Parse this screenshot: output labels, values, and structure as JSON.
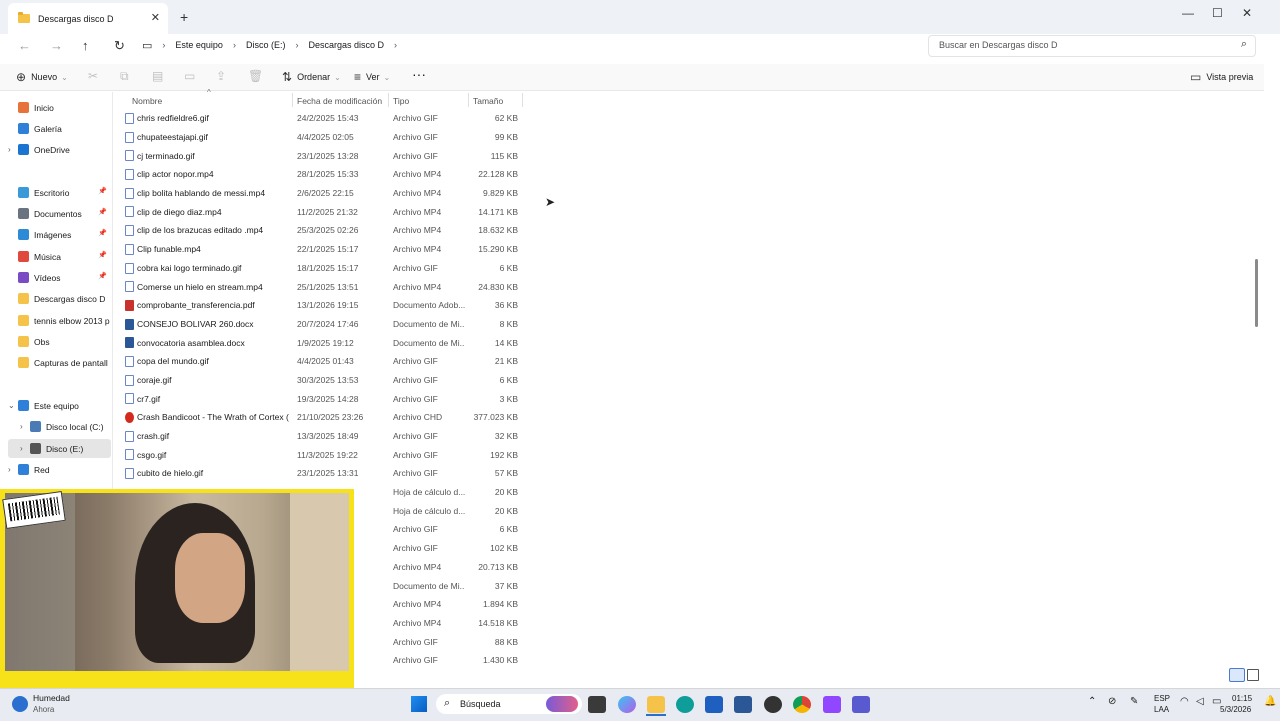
{
  "window": {
    "tab_title": "Descargas disco D",
    "new_tab": "+",
    "close_tab": "✕"
  },
  "address": {
    "breadcrumbs": [
      "Este equipo",
      "Disco (E:)",
      "Descargas disco D"
    ],
    "search_placeholder": "Buscar en Descargas disco D"
  },
  "toolbar": {
    "new_label": "Nuevo",
    "sort_label": "Ordenar",
    "view_label": "Ver",
    "more_label": "···",
    "preview_label": "Vista previa"
  },
  "sidebar": {
    "items": [
      {
        "label": "Inicio",
        "color": "#e8733a"
      },
      {
        "label": "Galería",
        "color": "#2f80d8"
      },
      {
        "label": "OneDrive",
        "color": "#1b74d0"
      },
      {
        "label": "Escritorio",
        "color": "#3a9ad9"
      },
      {
        "label": "Documentos",
        "color": "#6a7480"
      },
      {
        "label": "Imágenes",
        "color": "#2d8ad6"
      },
      {
        "label": "Música",
        "color": "#e04a3c"
      },
      {
        "label": "Vídeos",
        "color": "#7a4bc2"
      },
      {
        "label": "Descargas disco D",
        "color": "#f6c34a"
      },
      {
        "label": "tennis elbow 2013 p",
        "color": "#f6c34a"
      },
      {
        "label": "Obs",
        "color": "#f6c34a"
      },
      {
        "label": "Capturas de pantall",
        "color": "#f6c34a"
      },
      {
        "label": "Este equipo",
        "color": "#2f80d8"
      },
      {
        "label": "Disco local (C:)",
        "color": "#4a7bb5"
      },
      {
        "label": "Disco (E:)",
        "color": "#555555"
      },
      {
        "label": "Red",
        "color": "#2f80d8"
      }
    ]
  },
  "columns": {
    "name": "Nombre",
    "date": "Fecha de modificación",
    "type": "Tipo",
    "size": "Tamaño"
  },
  "files": [
    {
      "name": "chris redfieldre6.gif",
      "date": "24/2/2025 15:43",
      "type": "Archivo GIF",
      "size": "62 KB",
      "kind": "gif"
    },
    {
      "name": "chupateestajapi.gif",
      "date": "4/4/2025 02:05",
      "type": "Archivo GIF",
      "size": "99 KB",
      "kind": "gif"
    },
    {
      "name": "cj terminado.gif",
      "date": "23/1/2025 13:28",
      "type": "Archivo GIF",
      "size": "115 KB",
      "kind": "gif"
    },
    {
      "name": "clip actor nopor.mp4",
      "date": "28/1/2025 15:33",
      "type": "Archivo MP4",
      "size": "22.128 KB",
      "kind": "mp4"
    },
    {
      "name": "clip bolita hablando de messi.mp4",
      "date": "2/6/2025 22:15",
      "type": "Archivo MP4",
      "size": "9.829 KB",
      "kind": "mp4"
    },
    {
      "name": "clip de diego diaz.mp4",
      "date": "11/2/2025 21:32",
      "type": "Archivo MP4",
      "size": "14.171 KB",
      "kind": "mp4"
    },
    {
      "name": "clip de los brazucas editado .mp4",
      "date": "25/3/2025 02:26",
      "type": "Archivo MP4",
      "size": "18.632 KB",
      "kind": "mp4"
    },
    {
      "name": "Clip funable.mp4",
      "date": "22/1/2025 15:17",
      "type": "Archivo MP4",
      "size": "15.290 KB",
      "kind": "mp4"
    },
    {
      "name": "cobra kai logo terminado.gif",
      "date": "18/1/2025 15:17",
      "type": "Archivo GIF",
      "size": "6 KB",
      "kind": "gif"
    },
    {
      "name": "Comerse un hielo en stream.mp4",
      "date": "25/1/2025 13:51",
      "type": "Archivo MP4",
      "size": "24.830 KB",
      "kind": "mp4"
    },
    {
      "name": "comprobante_transferencia.pdf",
      "date": "13/1/2026 19:15",
      "type": "Documento Adob...",
      "size": "36 KB",
      "kind": "pdf"
    },
    {
      "name": "CONSEJO BOLIVAR 260.docx",
      "date": "20/7/2024 17:46",
      "type": "Documento de Mi...",
      "size": "8 KB",
      "kind": "doc"
    },
    {
      "name": "convocatoria asamblea.docx",
      "date": "1/9/2025 19:12",
      "type": "Documento de Mi...",
      "size": "14 KB",
      "kind": "doc"
    },
    {
      "name": "copa del mundo.gif",
      "date": "4/4/2025 01:43",
      "type": "Archivo GIF",
      "size": "21 KB",
      "kind": "gif"
    },
    {
      "name": "coraje.gif",
      "date": "30/3/2025 13:53",
      "type": "Archivo GIF",
      "size": "6 KB",
      "kind": "gif"
    },
    {
      "name": "cr7.gif",
      "date": "19/3/2025 14:28",
      "type": "Archivo GIF",
      "size": "3 KB",
      "kind": "gif"
    },
    {
      "name": "Crash Bandicoot - The Wrath of Cortex (E...",
      "date": "21/10/2025 23:26",
      "type": "Archivo CHD",
      "size": "377.023 KB",
      "kind": "chd"
    },
    {
      "name": "crash.gif",
      "date": "13/3/2025 18:49",
      "type": "Archivo GIF",
      "size": "32 KB",
      "kind": "gif"
    },
    {
      "name": "csgo.gif",
      "date": "11/3/2025 19:22",
      "type": "Archivo GIF",
      "size": "192 KB",
      "kind": "gif"
    },
    {
      "name": "cubito de hielo.gif",
      "date": "23/1/2025 13:31",
      "type": "Archivo GIF",
      "size": "57 KB",
      "kind": "gif"
    },
    {
      "name": "",
      "date": "",
      "type": "Hoja de cálculo d...",
      "size": "20 KB",
      "kind": "xls"
    },
    {
      "name": "",
      "date": "",
      "type": "Hoja de cálculo d...",
      "size": "20 KB",
      "kind": "xls"
    },
    {
      "name": "",
      "date": "",
      "type": "Archivo GIF",
      "size": "6 KB",
      "kind": "gif"
    },
    {
      "name": "",
      "date": "",
      "type": "Archivo GIF",
      "size": "102 KB",
      "kind": "gif"
    },
    {
      "name": "",
      "date": "",
      "type": "Archivo MP4",
      "size": "20.713 KB",
      "kind": "mp4"
    },
    {
      "name": "",
      "date": "",
      "type": "Documento de Mi...",
      "size": "37 KB",
      "kind": "doc"
    },
    {
      "name": "",
      "date": "",
      "type": "Archivo MP4",
      "size": "1.894 KB",
      "kind": "mp4"
    },
    {
      "name": "",
      "date": "",
      "type": "Archivo MP4",
      "size": "14.518 KB",
      "kind": "mp4"
    },
    {
      "name": "",
      "date": "",
      "type": "Archivo GIF",
      "size": "88 KB",
      "kind": "gif"
    },
    {
      "name": "",
      "date": "",
      "type": "Archivo GIF",
      "size": "1.430 KB",
      "kind": "gif"
    }
  ],
  "taskbar": {
    "weather_title": "Humedad",
    "weather_sub": "Ahora",
    "search_label": "Búsqueda",
    "lang_top": "ESP",
    "lang_bottom": "LAA",
    "time": "01:15",
    "date": "5/3/2026"
  }
}
